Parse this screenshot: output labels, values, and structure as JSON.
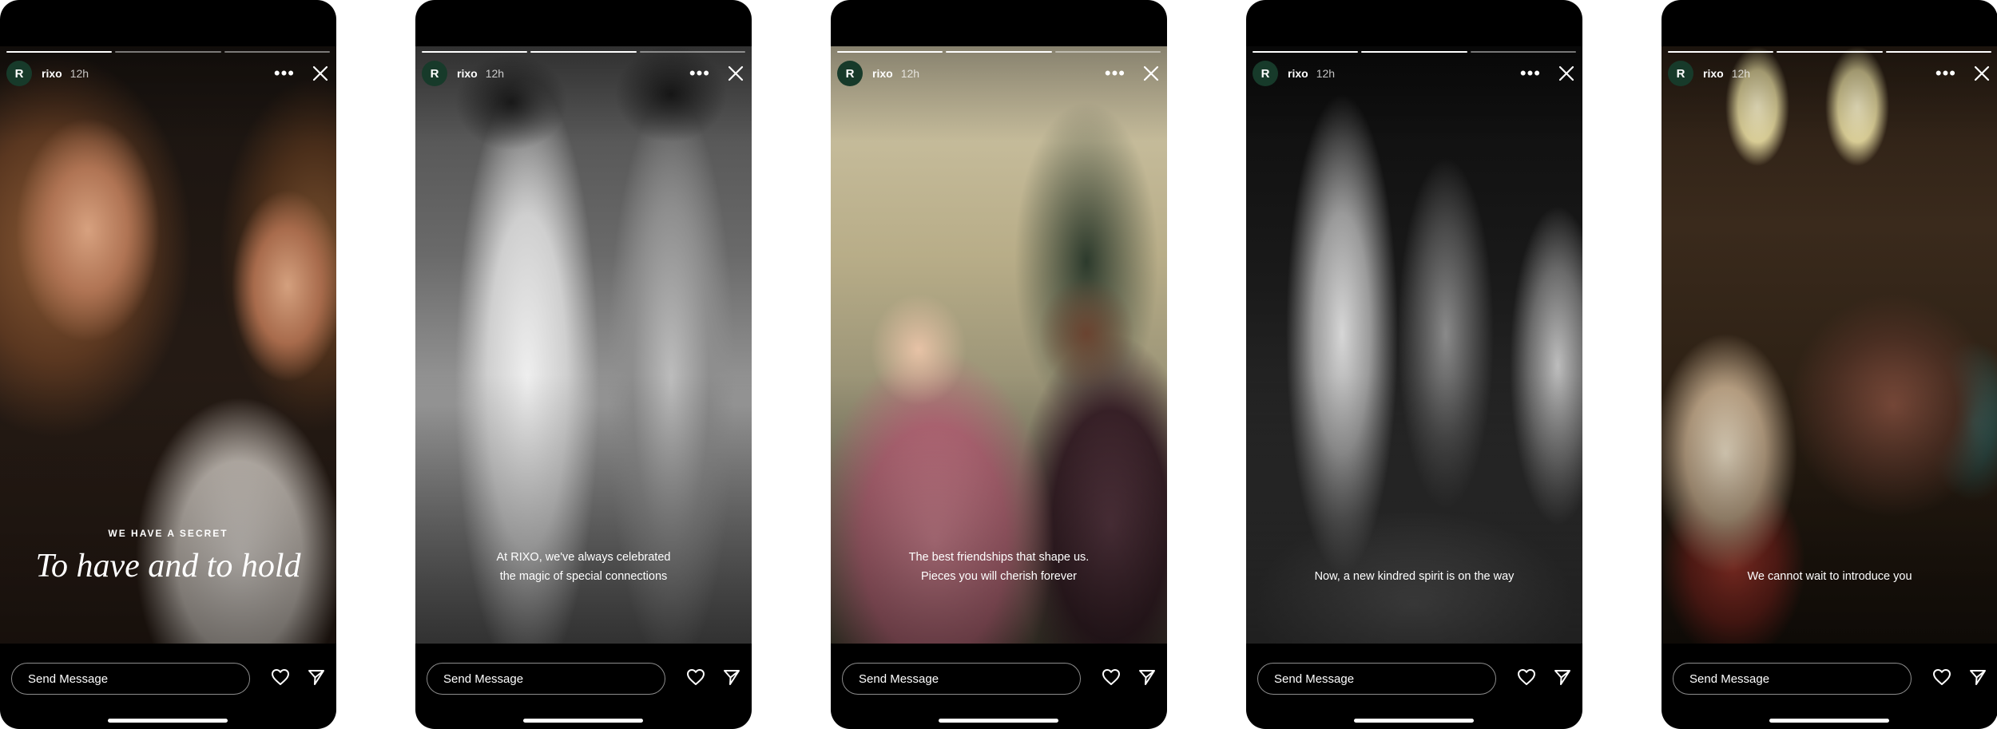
{
  "account": {
    "username": "rixo",
    "initial": "R",
    "time": "12h"
  },
  "footer": {
    "placeholder": "Send Message"
  },
  "stories": [
    {
      "kicker": "WE HAVE A SECRET",
      "headline": "To have and to hold",
      "lines": [],
      "active_segment": 1
    },
    {
      "kicker": "",
      "headline": "",
      "lines": [
        "At RIXO, we've always celebrated",
        "the magic of special connections"
      ],
      "active_segment": 2
    },
    {
      "kicker": "",
      "headline": "",
      "lines": [
        "The best friendships that shape us.",
        "Pieces you will cherish forever"
      ],
      "active_segment": 3
    },
    {
      "kicker": "",
      "headline": "",
      "lines": [
        "Now, a new kindred spirit is on the way"
      ],
      "active_segment": 4
    },
    {
      "kicker": "",
      "headline": "",
      "lines": [
        "We cannot wait to introduce you"
      ],
      "active_segment": 5
    }
  ],
  "icons": [
    "more-icon",
    "close-icon",
    "heart-icon",
    "send-icon"
  ]
}
